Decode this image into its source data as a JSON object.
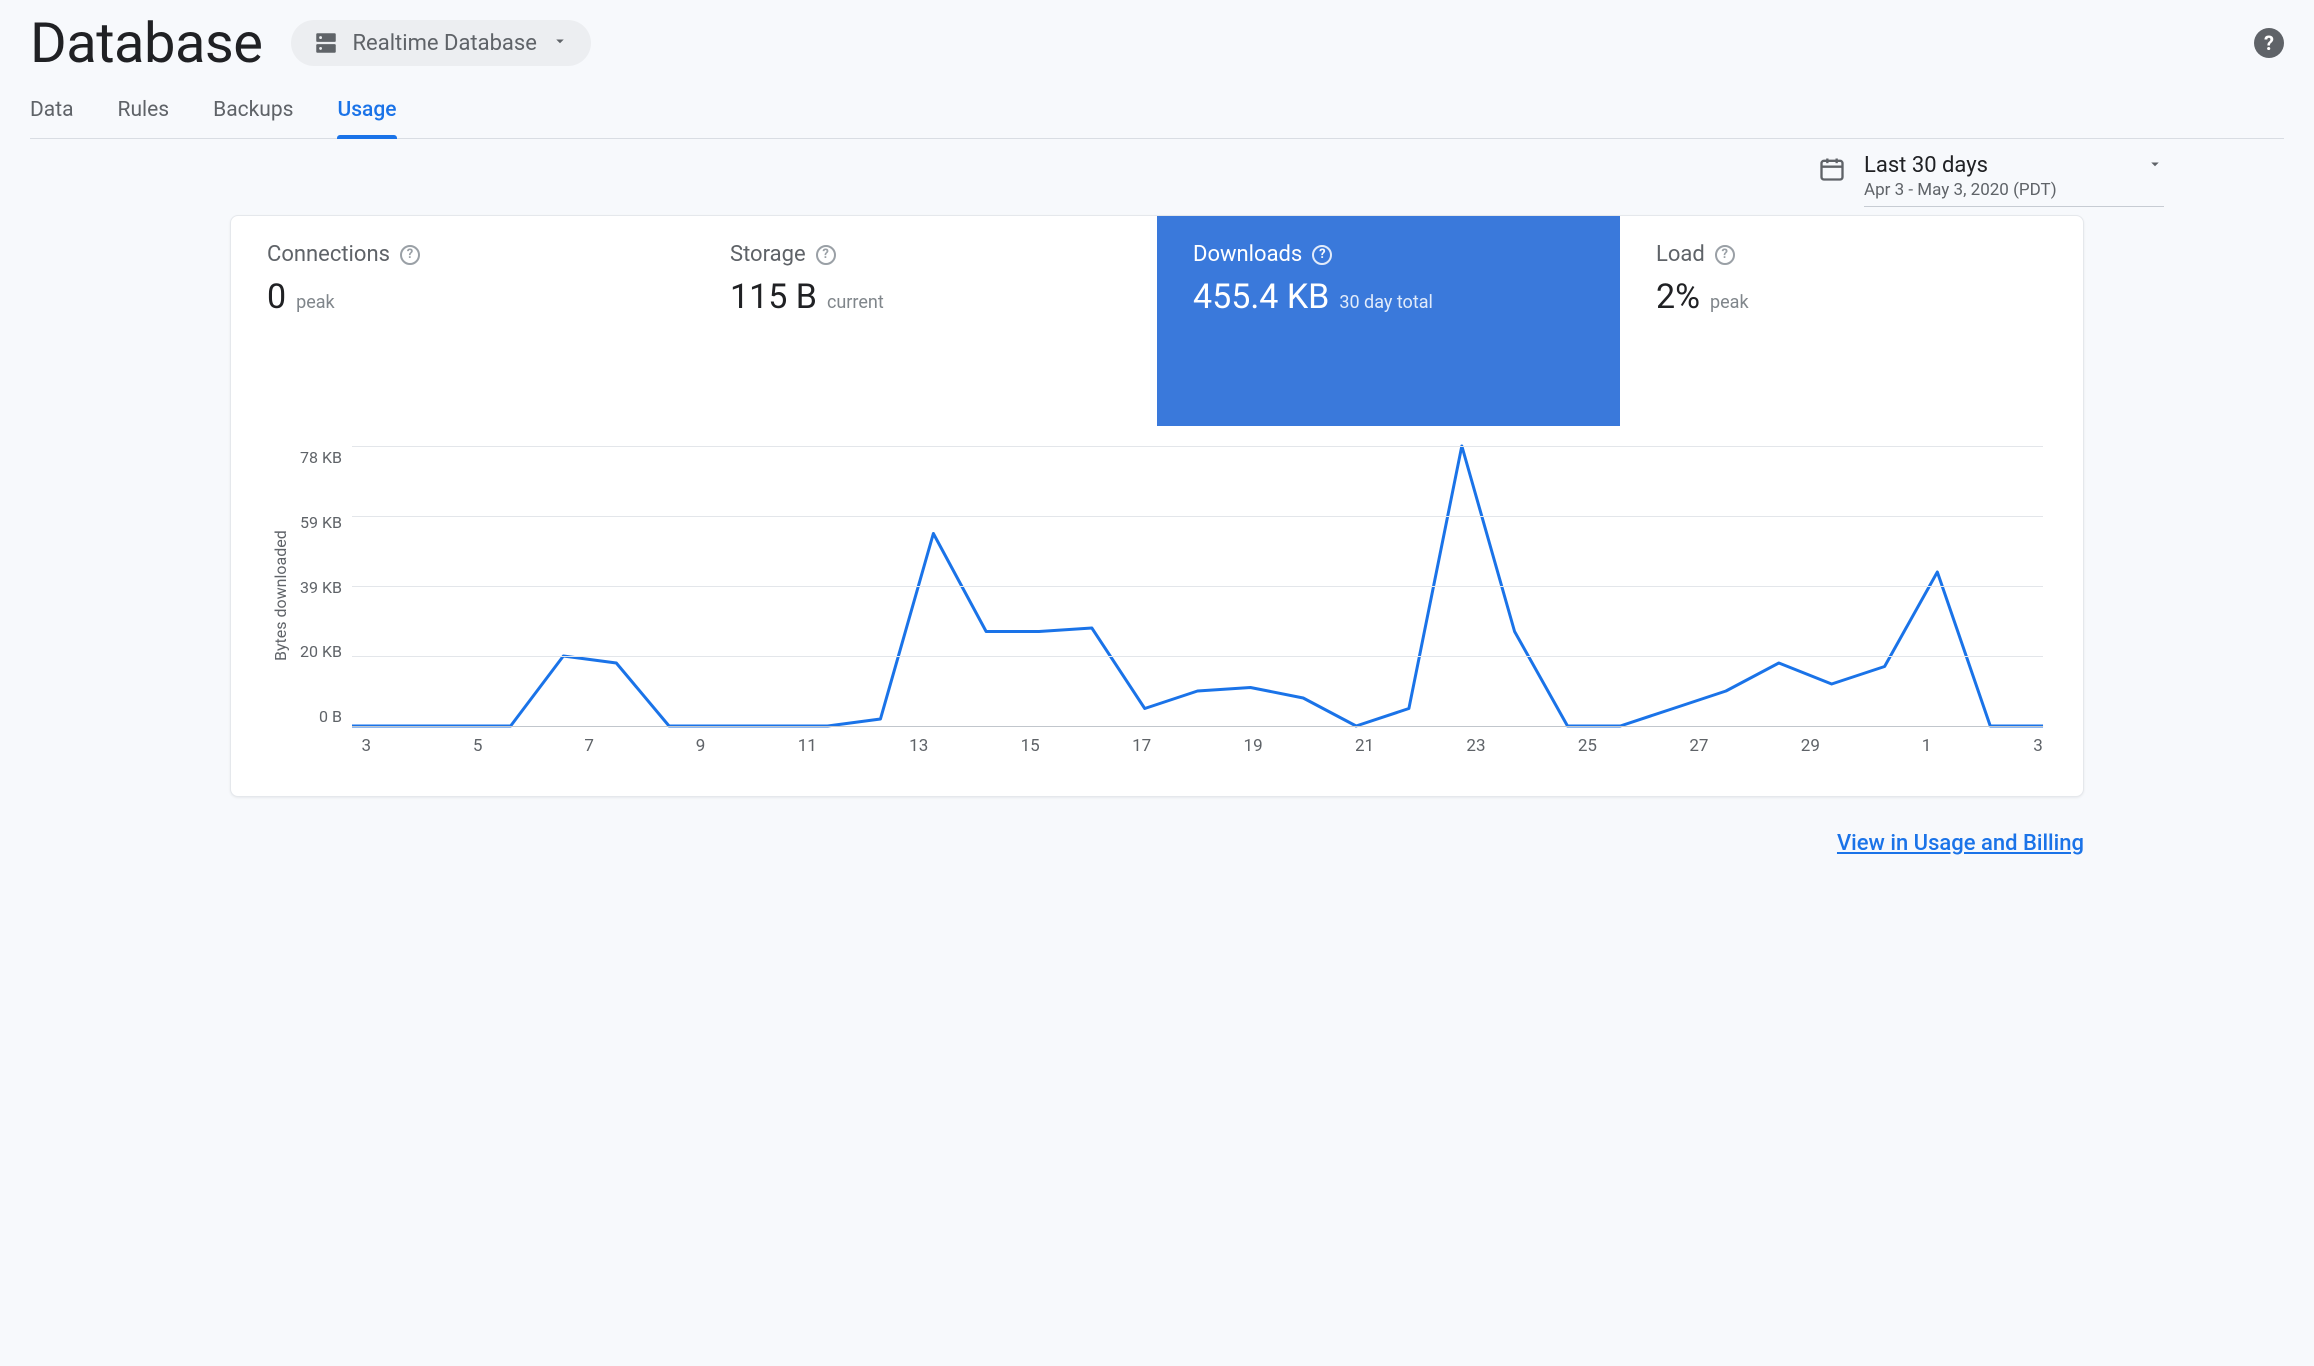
{
  "header": {
    "title": "Database",
    "selector_label": "Realtime Database"
  },
  "tabs": [
    {
      "key": "data",
      "label": "Data",
      "active": false
    },
    {
      "key": "rules",
      "label": "Rules",
      "active": false
    },
    {
      "key": "backups",
      "label": "Backups",
      "active": false
    },
    {
      "key": "usage",
      "label": "Usage",
      "active": true
    }
  ],
  "date": {
    "range": "Last 30 days",
    "detail": "Apr 3 - May 3, 2020 (PDT)"
  },
  "metrics": {
    "connections": {
      "title": "Connections",
      "value": "0",
      "sub": "peak",
      "selected": false
    },
    "storage": {
      "title": "Storage",
      "value": "115 B",
      "sub": "current",
      "selected": false
    },
    "downloads": {
      "title": "Downloads",
      "value": "455.4 KB",
      "sub": "30 day total",
      "selected": true
    },
    "load": {
      "title": "Load",
      "value": "2%",
      "sub": "peak",
      "selected": false
    }
  },
  "chart_data": {
    "type": "line",
    "title": "",
    "ylabel": "Bytes downloaded",
    "xlabel": "",
    "y_ticks": [
      "78 KB",
      "59 KB",
      "39 KB",
      "20 KB",
      "0 B"
    ],
    "x_ticks": [
      "3",
      "5",
      "7",
      "9",
      "11",
      "13",
      "15",
      "17",
      "19",
      "21",
      "23",
      "25",
      "27",
      "29",
      "1",
      "3"
    ],
    "x": [
      3,
      4,
      5,
      6,
      7,
      8,
      9,
      10,
      11,
      12,
      13,
      14,
      15,
      16,
      17,
      18,
      19,
      20,
      21,
      22,
      23,
      24,
      25,
      26,
      27,
      28,
      29,
      30,
      1,
      2,
      3
    ],
    "values_kb": [
      0,
      0,
      0,
      0,
      20,
      18,
      0,
      0,
      0,
      0,
      2,
      55,
      27,
      27,
      28,
      5,
      10,
      11,
      8,
      0,
      5,
      80,
      27,
      0,
      0,
      5,
      10,
      18,
      12,
      17,
      44,
      0,
      0
    ],
    "ylim": [
      0,
      80
    ],
    "color": "#1a73e8"
  },
  "footer": {
    "view_link": "View in Usage and Billing"
  }
}
